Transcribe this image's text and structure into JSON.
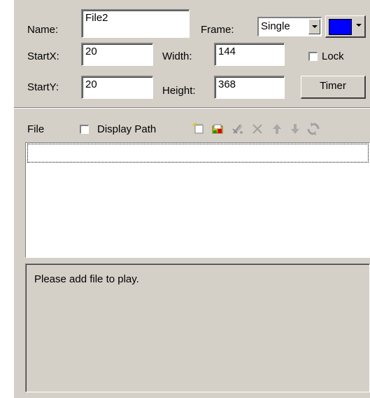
{
  "properties": {
    "name_label": "Name:",
    "name_value": "File2",
    "frame_label": "Frame:",
    "frame_value": "Single",
    "frame_color": "#0000ff",
    "startx_label": "StartX:",
    "startx_value": "20",
    "width_label": "Width:",
    "width_value": "144",
    "lock_label": "Lock",
    "lock_checked": false,
    "starty_label": "StartY:",
    "starty_value": "20",
    "height_label": "Height:",
    "height_value": "368",
    "timer_label": "Timer"
  },
  "file_toolbar": {
    "file_label": "File",
    "display_path_label": "Display Path",
    "display_path_checked": false,
    "icons": [
      "new-file-icon",
      "add-folder-icon",
      "clear-list-icon",
      "delete-icon",
      "move-up-icon",
      "move-down-icon",
      "refresh-icon"
    ]
  },
  "file_list": {
    "rows": [
      ""
    ]
  },
  "info": {
    "message": "Please add file to play."
  }
}
